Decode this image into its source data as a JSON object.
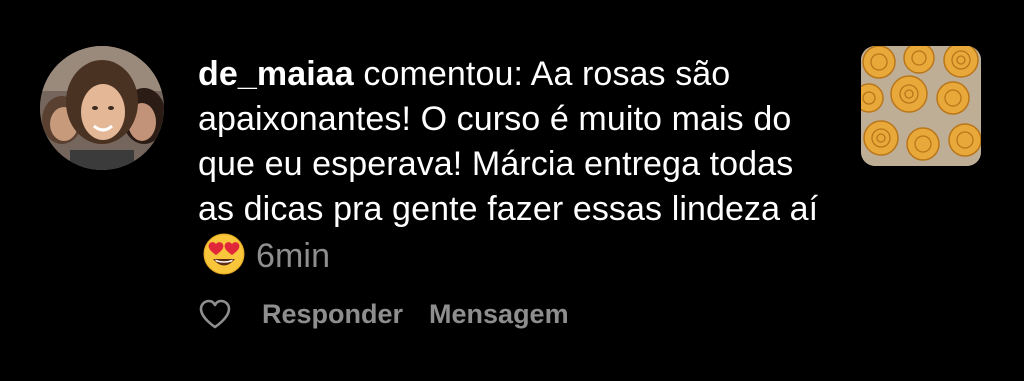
{
  "comment": {
    "username": "de_maiaa",
    "action_text": " comentou: Aa rosas são apaixonantes! O curso é muito mais do que eu esperava! Márcia entrega todas as dicas pra gente fazer essas lindeza aí",
    "emoji": "smiling-face-with-heart-eyes",
    "time": "6min"
  },
  "actions": {
    "like_icon": "heart-outline-icon",
    "reply_label": "Responder",
    "message_label": "Mensagem"
  },
  "colors": {
    "background": "#000000",
    "text": "#ffffff",
    "muted": "#8e8e8e"
  }
}
